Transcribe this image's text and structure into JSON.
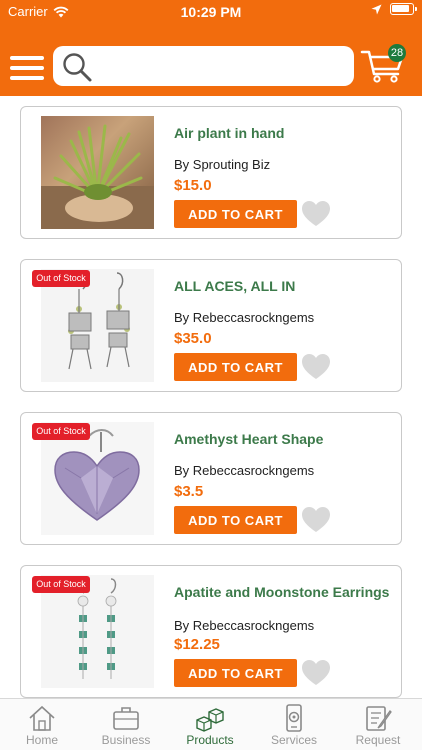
{
  "status_bar": {
    "carrier": "Carrier",
    "time": "10:29 PM"
  },
  "header": {
    "search": {
      "placeholder": ""
    },
    "cart_count": "28"
  },
  "products": [
    {
      "title": "Air plant in hand",
      "seller": "By Sprouting Biz",
      "price": "$15.0",
      "button": "ADD TO CART",
      "out_of_stock": false,
      "badge": ""
    },
    {
      "title": "ALL ACES, ALL IN",
      "seller": "By Rebeccasrockngems",
      "price": "$35.0",
      "button": "ADD TO CART",
      "out_of_stock": true,
      "badge": "Out of Stock"
    },
    {
      "title": "Amethyst Heart Shape",
      "seller": "By Rebeccasrockngems",
      "price": "$3.5",
      "button": "ADD TO CART",
      "out_of_stock": true,
      "badge": "Out of Stock"
    },
    {
      "title": "Apatite and Moonstone Earrings",
      "seller": "By Rebeccasrockngems",
      "price": "$12.25",
      "button": "ADD TO CART",
      "out_of_stock": true,
      "badge": "Out of Stock"
    }
  ],
  "tabs": [
    {
      "label": "Home",
      "icon": "home-icon",
      "active": false
    },
    {
      "label": "Business",
      "icon": "briefcase-icon",
      "active": false
    },
    {
      "label": "Products",
      "icon": "boxes-icon",
      "active": true
    },
    {
      "label": "Services",
      "icon": "services-icon",
      "active": false
    },
    {
      "label": "Request",
      "icon": "request-icon",
      "active": false
    }
  ],
  "colors": {
    "brand_orange": "#f26c0d",
    "title_green": "#3c7a4a",
    "badge_red": "#e3202a",
    "cart_badge_green": "#1e7a3c",
    "tab_inactive": "#9a9a9a"
  }
}
